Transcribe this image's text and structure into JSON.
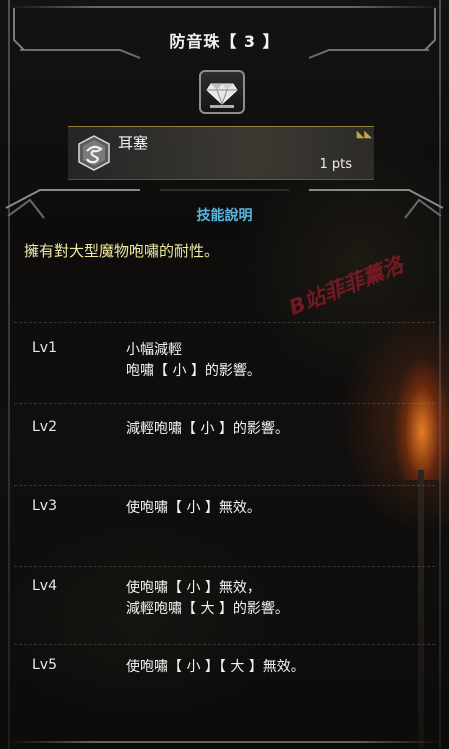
{
  "header": {
    "title": "防音珠【 3 】",
    "decoration_icon": "diamond-jewel-icon"
  },
  "skill": {
    "icon": "earplug-skill-icon",
    "name": "耳塞",
    "points": "1 pts"
  },
  "description": {
    "section_title": "技能說明",
    "text": "擁有對大型魔物咆嘯的耐性。"
  },
  "levels": [
    {
      "label": "Lv1",
      "text": "小幅減輕\n咆嘯【 小 】的影響。"
    },
    {
      "label": "Lv2",
      "text": "減輕咆嘯【 小 】的影響。"
    },
    {
      "label": "Lv3",
      "text": "使咆嘯【 小 】無效。"
    },
    {
      "label": "Lv4",
      "text": "使咆嘯【 小 】無效，\n減輕咆嘯【 大 】的影響。"
    },
    {
      "label": "Lv5",
      "text": "使咆嘯【 小 】【 大 】無效。"
    }
  ],
  "watermark": "B站菲菲薰洛",
  "colors": {
    "section_title": "#5ab8e0",
    "description_text": "#f1ea9e",
    "accent_gold": "#c9a34a"
  }
}
